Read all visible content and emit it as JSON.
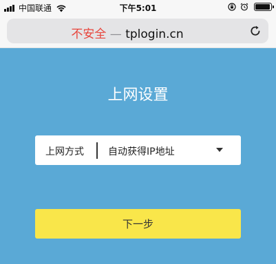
{
  "status_bar": {
    "carrier": "中国联通",
    "time": "下午5:01",
    "icons": [
      "signal-icon",
      "wifi-icon",
      "orientation-lock-icon",
      "alarm-icon",
      "battery-icon"
    ],
    "battery_level": 0.95
  },
  "browser": {
    "security_label": "不安全",
    "separator": "—",
    "url": "tplogin.cn",
    "reload_icon": "reload-icon"
  },
  "page": {
    "title": "上网设置",
    "connection_field": {
      "label": "上网方式",
      "value": "自动获得IP地址",
      "dropdown_icon": "caret-down-icon"
    },
    "next_button_label": "下一步"
  },
  "colors": {
    "background": "#5aa9d6",
    "button": "#f9e64a",
    "insecure": "#e8453c"
  }
}
